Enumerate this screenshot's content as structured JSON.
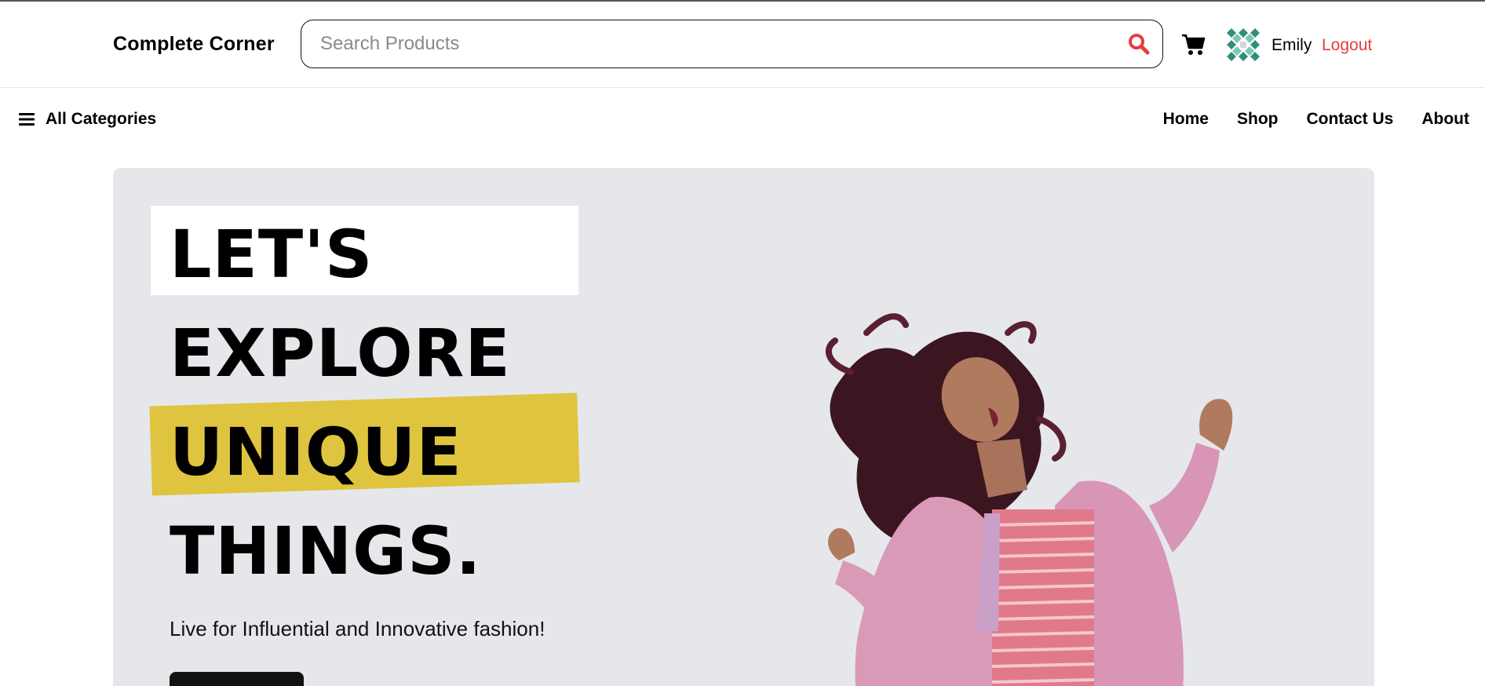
{
  "header": {
    "brand": "Complete Corner",
    "search": {
      "placeholder": "Search Products",
      "value": ""
    },
    "user": {
      "name": "Emily",
      "logout_label": "Logout"
    }
  },
  "nav": {
    "all_categories": "All Categories",
    "links": [
      "Home",
      "Shop",
      "Contact Us",
      "About"
    ]
  },
  "hero": {
    "headline": [
      "LET'S",
      "EXPLORE",
      "UNIQUE",
      "THINGS."
    ],
    "tagline": "Live for Influential and Innovative fashion!",
    "highlight_color": "#dfc43f",
    "background_color": "#e5e7eb"
  },
  "colors": {
    "accent": "#e53e3e",
    "text": "#000000"
  },
  "icons": [
    "search-icon",
    "cart-icon",
    "avatar",
    "menu-icon"
  ]
}
